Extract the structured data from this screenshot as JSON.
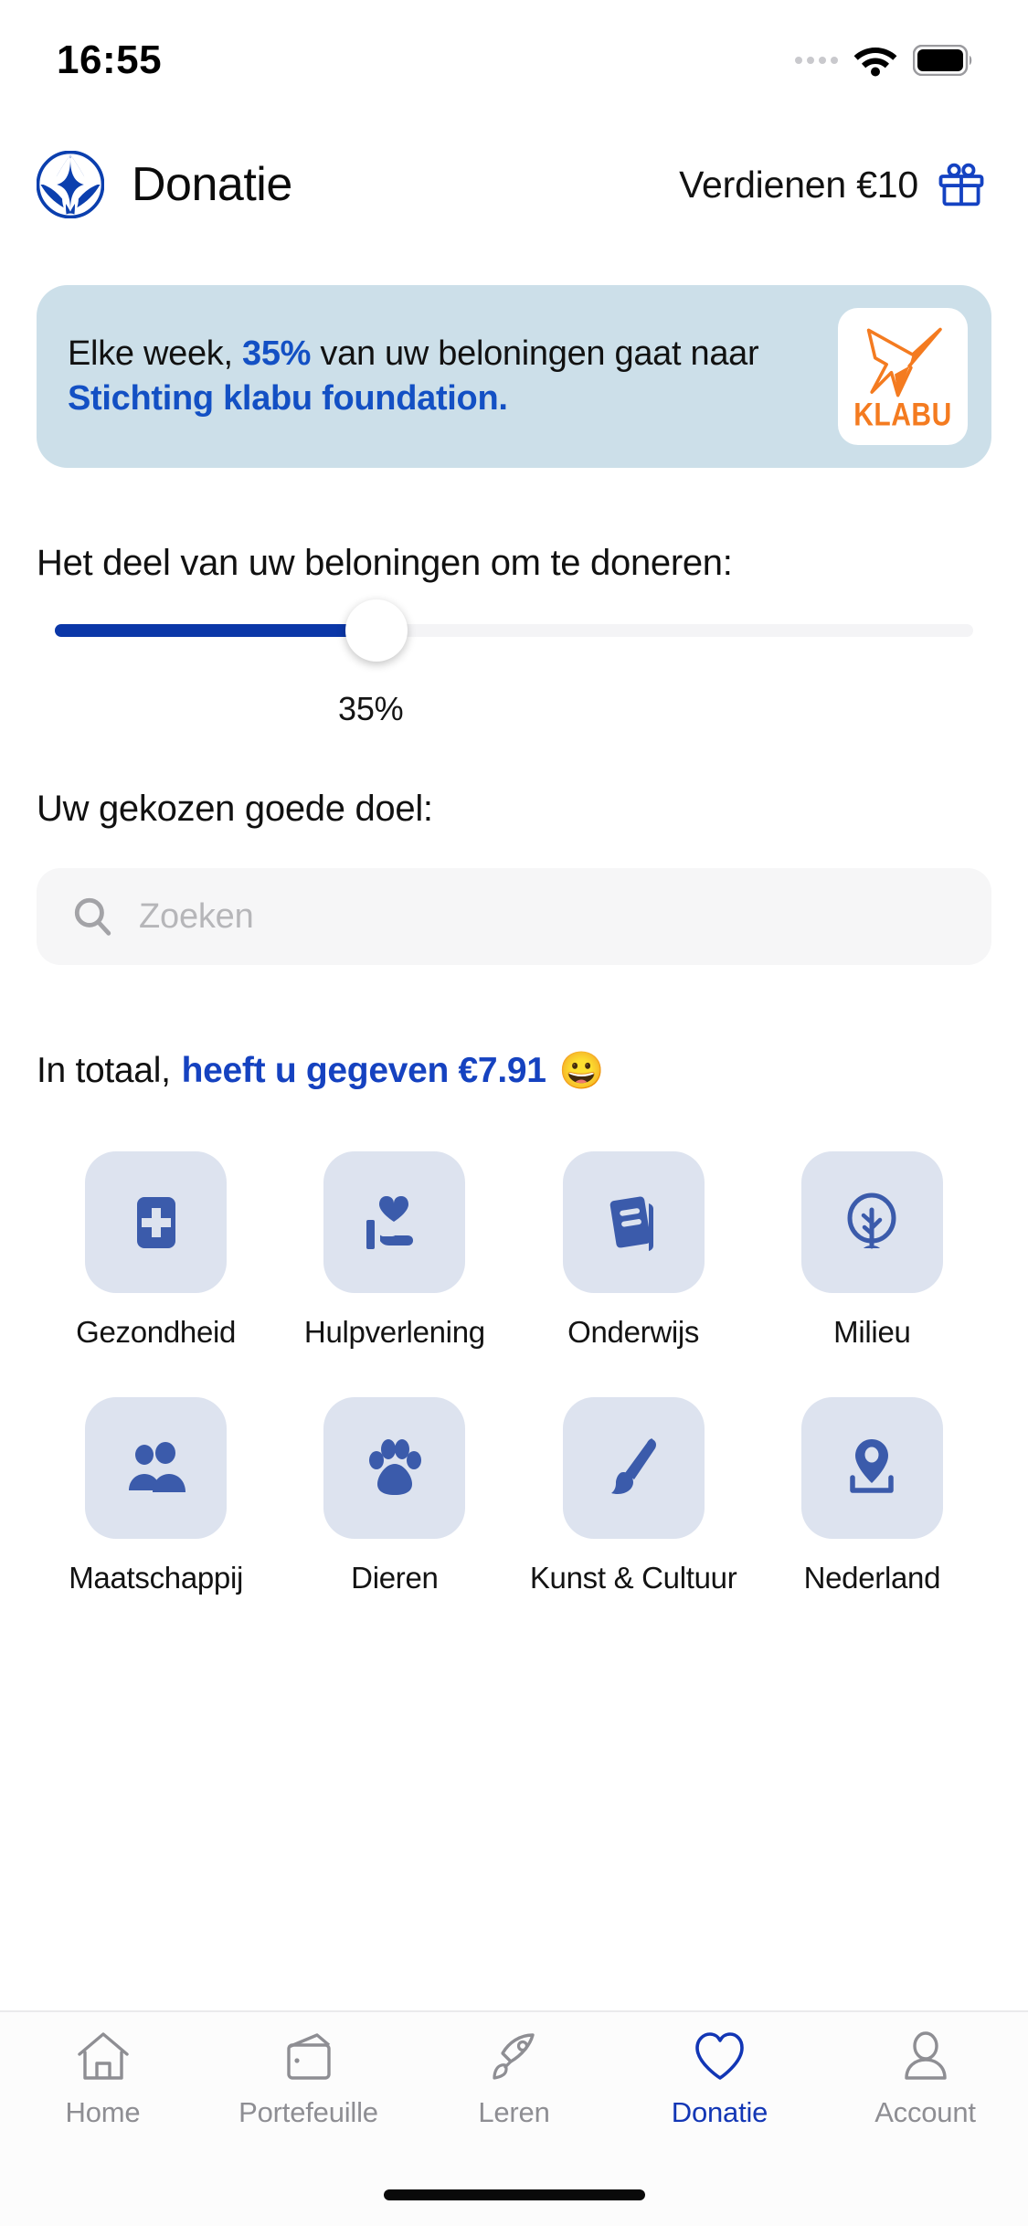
{
  "status_bar": {
    "time": "16:55",
    "signal_icon": "signal-dots-icon",
    "wifi_icon": "wifi-icon",
    "battery_icon": "battery-full-icon"
  },
  "header": {
    "logo_icon": "app-logo-icon",
    "title": "Donatie",
    "earn_label": "Verdienen €10",
    "gift_icon": "gift-icon"
  },
  "banner": {
    "text_part1": "Elke week, ",
    "highlight_percent": "35%",
    "text_part2": " van uw beloningen gaat naar ",
    "highlight_org": "Stichting klabu foundation.",
    "logo": {
      "bird_icon": "klabu-bird-icon",
      "wordmark": "KLABU",
      "brand_color": "#f47b20",
      "tile_color": "#ffffff"
    },
    "background_color": "#ccdfe9"
  },
  "share_section": {
    "label": "Het deel van uw beloningen om te doneren:",
    "slider": {
      "value": 35,
      "min": 0,
      "max": 100,
      "value_label": "35%",
      "fill_color": "#0b37a8",
      "track_color": "#f4f4f6"
    }
  },
  "charity_section": {
    "label": "Uw gekozen goede doel:",
    "search": {
      "placeholder": "Zoeken",
      "value": "",
      "icon": "search-icon"
    }
  },
  "total_section": {
    "prefix": "In totaal,",
    "accent": "heeft u gegeven €7.91",
    "emoji": "😀"
  },
  "categories": [
    {
      "label": "Gezondheid",
      "icon": "medical-cross-icon"
    },
    {
      "label": "Hulpverlening",
      "icon": "hand-heart-icon"
    },
    {
      "label": "Onderwijs",
      "icon": "book-icon"
    },
    {
      "label": "Milieu",
      "icon": "tree-icon"
    },
    {
      "label": "Maatschappij",
      "icon": "people-icon"
    },
    {
      "label": "Dieren",
      "icon": "paw-icon"
    },
    {
      "label": "Kunst & Cultuur",
      "icon": "paintbrush-icon"
    },
    {
      "label": "Nederland",
      "icon": "map-pin-icon"
    }
  ],
  "tabbar": {
    "active_index": 3,
    "active_color": "#1236b5",
    "inactive_color": "#8e8e93",
    "items": [
      {
        "label": "Home",
        "icon": "home-icon"
      },
      {
        "label": "Portefeuille",
        "icon": "wallet-icon"
      },
      {
        "label": "Leren",
        "icon": "rocket-icon"
      },
      {
        "label": "Donatie",
        "icon": "heart-icon"
      },
      {
        "label": "Account",
        "icon": "person-icon"
      }
    ]
  },
  "theme": {
    "brand_blue": "#1442c2",
    "tile_blue": "#dde3ef",
    "icon_blue": "#3b5bab"
  }
}
